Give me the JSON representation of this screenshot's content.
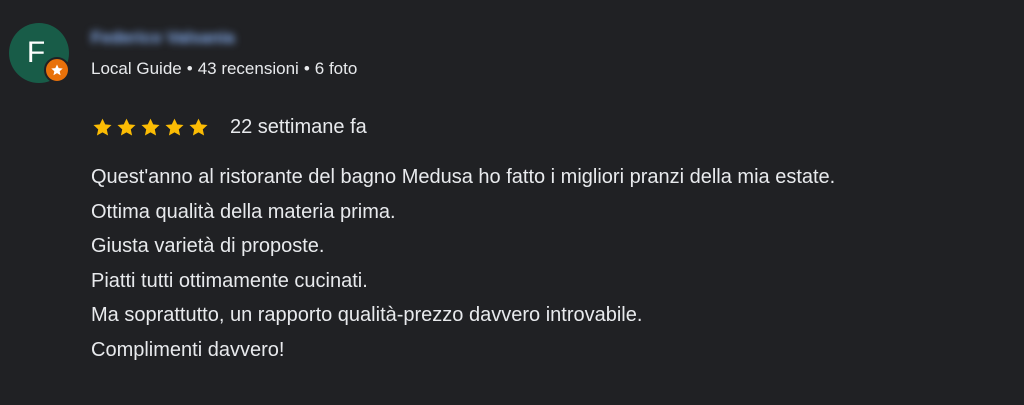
{
  "reviewer": {
    "initial": "F",
    "name": "Federico Valsania",
    "level": "Local Guide",
    "reviews": "43 recensioni",
    "photos": "6 foto",
    "separator": "•",
    "avatar_color": "#185c48",
    "badge_color": "#e8710a",
    "badge_icon": "star-icon"
  },
  "review": {
    "rating": 5,
    "max_rating": 5,
    "star_color": "#fbbc04",
    "time": "22 settimane fa",
    "lines": [
      "Quest'anno al ristorante del bagno Medusa ho fatto i migliori pranzi della mia estate.",
      "Ottima qualità della materia prima.",
      "Giusta varietà di proposte.",
      "Piatti tutti ottimamente cucinati.",
      "Ma soprattutto, un rapporto qualità-prezzo davvero introvabile.",
      "Complimenti davvero!"
    ]
  }
}
